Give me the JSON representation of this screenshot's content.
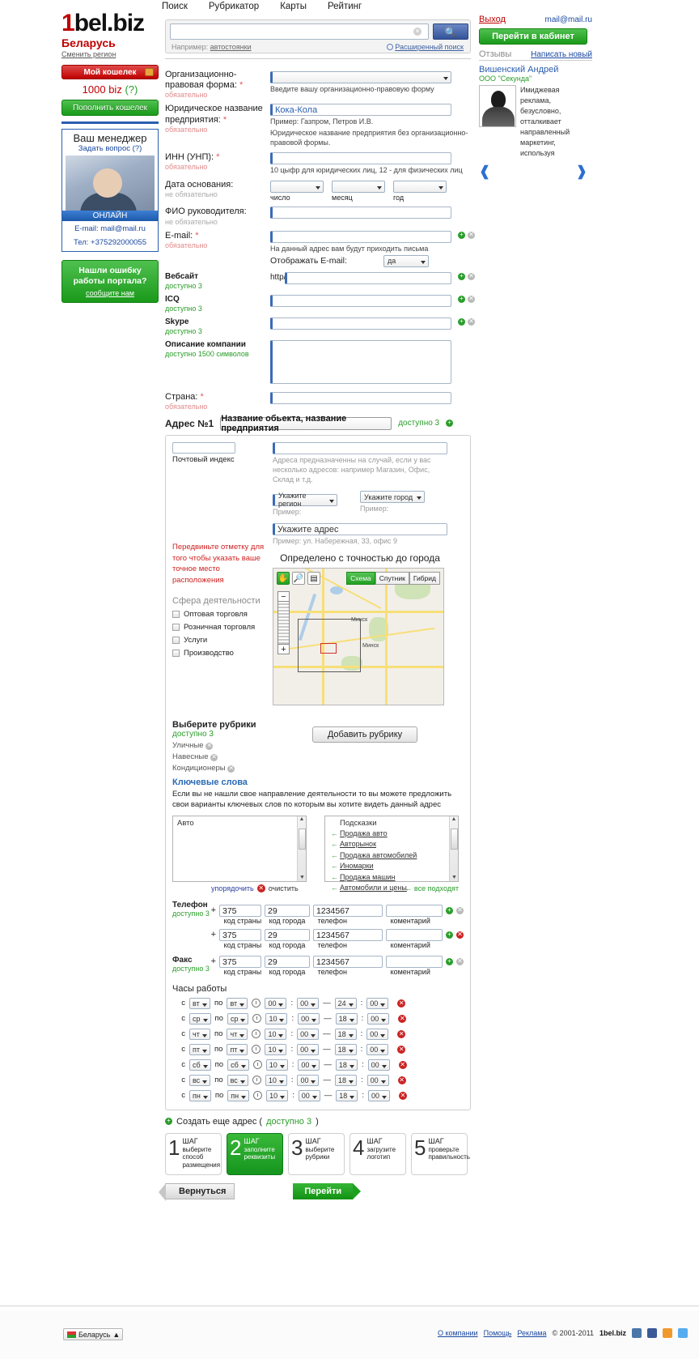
{
  "topnav": [
    "Поиск",
    "Рубрикатор",
    "Карты",
    "Рейтинг"
  ],
  "brand": {
    "one": "1",
    "rest": "bel.biz",
    "country": "Беларусь",
    "change_region": "Сменить регион"
  },
  "wallet": {
    "my_wallet": "Мой кошелек",
    "amount": "1000",
    "currency": "biz",
    "help": "(?)",
    "topup": "Пополнить кошелек"
  },
  "manager": {
    "title": "Ваш менеджер",
    "ask": "Задать вопрос (?)",
    "status": "ОНЛАЙН",
    "email": "E-mail: mail@mail.ru",
    "phone": "Тел: +375292000055"
  },
  "bugbox": {
    "line1": "Нашли ошибку",
    "line2": "работы портала?",
    "line3": "сообщите нам"
  },
  "search": {
    "value": "",
    "placeholder": "",
    "hint_prefix": "Например:",
    "hint_link": "автостоянки",
    "advanced": "Расширенный поиск",
    "button_icon": "search-icon"
  },
  "account": {
    "logout": "Выход",
    "email": "mail@mail.ru",
    "cabinet": "Перейти в кабинет",
    "reviews_label": "Отзывы",
    "write_new": "Написать новый",
    "review_author": "Вишенский Андрей",
    "review_company": "ООО \"Секунда\"",
    "review_text": "Имиджевая реклама, безусловно, отталкивает направленный маркетинг, используя"
  },
  "form": {
    "legal_form": {
      "label": "Организационно-правовая форма:",
      "req_mark": "*",
      "note": "обязательно",
      "select_value": "",
      "hint": "Введите вашу организационно-правовую форму"
    },
    "legal_name": {
      "label": "Юридическое название предприятия:",
      "req_mark": "*",
      "note": "обязательно",
      "value": "Кока-Кола",
      "hint1": "Пример: Газпром, Петров И.В.",
      "hint2": "Юридическое название предприятия без организационно-правовой формы."
    },
    "inn": {
      "label": "ИНН  (УНП):",
      "req_mark": "*",
      "note": "обязательно",
      "value": "",
      "hint": "10 цыфр для юридических лиц, 12 - для физических лиц"
    },
    "founded": {
      "label": "Дата основания:",
      "note": "не обязательно",
      "day": "",
      "month": "",
      "year": "",
      "cap_day": "число",
      "cap_month": "месяц",
      "cap_year": "год"
    },
    "director": {
      "label": "ФИО руководителя:",
      "note": "не обязательно",
      "value": ""
    },
    "email": {
      "label": "E-mail:",
      "req_mark": "*",
      "note": "обязательно",
      "value": "",
      "hint": "На данный адрес вам будут приходить письма",
      "show_label": "Отображать E-mail:",
      "show_value": "да"
    },
    "website": {
      "label": "Вебсайт",
      "note": "доступно 3",
      "prefix": "http//",
      "value": ""
    },
    "icq": {
      "label": "ICQ",
      "note": "доступно 3",
      "value": ""
    },
    "skype": {
      "label": "Skype",
      "note": "доступно 3",
      "value": ""
    },
    "description": {
      "label": "Описание компании",
      "note": "доступно 1500 символов",
      "value": ""
    },
    "country": {
      "label": "Страна:",
      "req_mark": "*",
      "note": "обязательно",
      "value": ""
    }
  },
  "address": {
    "title": "Адрес №1",
    "name_button": "Название обьекта, название предприятия",
    "available": "доступно 3",
    "zip_value": "",
    "zip_caption": "Почтовый индекс",
    "addr_kind_value": "",
    "addr_kind_hint": "Адреса предназначенны на случай, если у вас несколько адресов: например Магазин, Офис, Склад и т.д.",
    "region_value": "Укажите регион",
    "region_hint": "Пример:",
    "city_value": "Укажите город",
    "city_hint": "Пример:",
    "street_value": "Укажите адрес",
    "street_hint": "Пример: ул. Набережная, 33, офис 9",
    "accuracy": "Определено с точностью до города",
    "marker_note": "Передвиньте отметку для того чтобы указать ваше точное место расположения",
    "map": {
      "tabs": [
        "Схема",
        "Спутник",
        "Гибрид"
      ],
      "active_tab": "Схема",
      "controls": [
        "hand-icon",
        "zoom-out-icon",
        "ruler-icon"
      ],
      "labels": [
        "Минск",
        "Минск"
      ]
    },
    "sphere_title": "Сфера деятельности",
    "sphere_items": [
      "Оптовая торговля",
      "Розничная торговля",
      "Услуги",
      "Производство"
    ],
    "rubrics_title": "Выберите рубрики",
    "rubrics_available": "доступно 3",
    "rubrics": [
      "Уличные",
      "Навесные",
      "Кондиционеры"
    ],
    "add_rubric_button": "Добавить рубрику",
    "keywords_title": "Ключевые слова",
    "keywords_desc": "Если вы не нашли свое направление деятельности то вы можете предложить свои варианты ключевых слов по которым вы хотите видеть данный адрес",
    "keywords_box_label": "Авто",
    "suggestions_label": "Подсказки",
    "suggestions": [
      "Продажа авто",
      "Авторынок",
      "Продажа автомобилей",
      "Иномарки",
      "Продажа машин",
      "Автомобили и цены"
    ],
    "kw_sort": "упорядочить",
    "kw_clear": "очистить",
    "kw_all": "все подходят",
    "phone_label": "Телефон",
    "phone_available": "доступно 3",
    "fax_label": "Факс",
    "fax_available": "доступно 3",
    "phone_caps": [
      "код страны",
      "код города",
      "телефон",
      "коментарий"
    ],
    "phones": [
      {
        "country": "375",
        "city": "29",
        "number": "1234567",
        "comment": ""
      },
      {
        "country": "375",
        "city": "29",
        "number": "1234567",
        "comment": ""
      }
    ],
    "fax": {
      "country": "375",
      "city": "29",
      "number": "1234567",
      "comment": ""
    },
    "hours_title": "Часы работы",
    "hours_from": "с",
    "hours_to": "по",
    "hours": [
      {
        "d1": "вт",
        "d2": "вт",
        "h1": "00",
        "m1": "00",
        "h2": "24",
        "m2": "00"
      },
      {
        "d1": "ср",
        "d2": "ср",
        "h1": "10",
        "m1": "00",
        "h2": "18",
        "m2": "00"
      },
      {
        "d1": "чт",
        "d2": "чт",
        "h1": "10",
        "m1": "00",
        "h2": "18",
        "m2": "00"
      },
      {
        "d1": "пт",
        "d2": "пт",
        "h1": "10",
        "m1": "00",
        "h2": "18",
        "m2": "00"
      },
      {
        "d1": "сб",
        "d2": "сб",
        "h1": "10",
        "m1": "00",
        "h2": "18",
        "m2": "00"
      },
      {
        "d1": "вс",
        "d2": "вс",
        "h1": "10",
        "m1": "00",
        "h2": "18",
        "m2": "00"
      },
      {
        "d1": "пн",
        "d2": "пн",
        "h1": "10",
        "m1": "00",
        "h2": "18",
        "m2": "00"
      }
    ]
  },
  "create_more": {
    "text": "Создать еще адрес (",
    "available": "доступно 3",
    "close": ")"
  },
  "steps": [
    {
      "num": "1",
      "word": "ШАГ",
      "desc": "выберите способ размещения",
      "active": false
    },
    {
      "num": "2",
      "word": "ШАГ",
      "desc": "заполните реквизиты",
      "active": true
    },
    {
      "num": "3",
      "word": "ШАГ",
      "desc": "выберите рубрики",
      "active": false
    },
    {
      "num": "4",
      "word": "ШАГ",
      "desc": "загрузите логотип",
      "active": false
    },
    {
      "num": "5",
      "word": "ШАГ",
      "desc": "проверьте правильность",
      "active": false
    }
  ],
  "nav": {
    "back": "Вернуться",
    "go": "Перейти"
  },
  "footer": {
    "region": "Беларусь",
    "region_caret": "▲",
    "links": [
      "О компании",
      "Помощь",
      "Реклама"
    ],
    "copyright": "© 2001-2011",
    "brand": "1bel.biz",
    "socials": [
      "vk-icon",
      "facebook-icon",
      "rss-icon",
      "twitter-icon"
    ]
  },
  "colors": {
    "green": "#1a9a1a",
    "red": "#c00000",
    "blue": "#2b5fb0",
    "link": "#1a48a0"
  }
}
